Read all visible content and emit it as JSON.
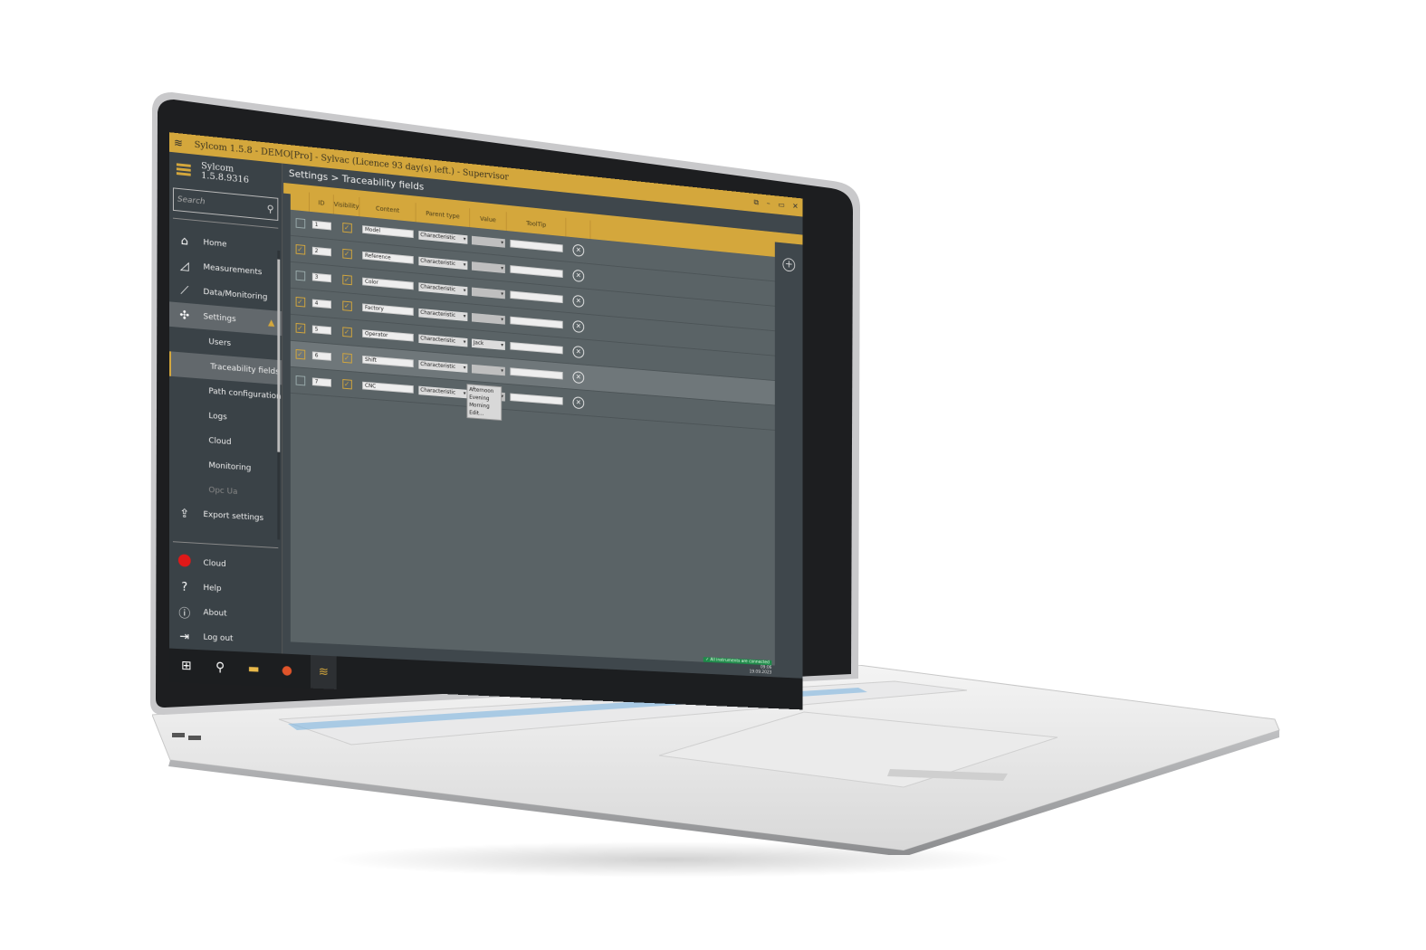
{
  "window": {
    "title": "Sylcom 1.5.8 - DEMO[Pro] - Sylvac (Licence 93 day(s) left.) - Supervisor",
    "buttons": {
      "popout": "⧉",
      "minimize": "–",
      "restore": "▭",
      "close": "✕"
    }
  },
  "sidebar": {
    "app_version": "Sylcom 1.5.8.9316",
    "search_placeholder": "Search",
    "items": [
      {
        "label": "Home",
        "icon": "home-icon",
        "glyph": "⌂"
      },
      {
        "label": "Measurements",
        "icon": "set-square-icon",
        "glyph": "◿"
      },
      {
        "label": "Data/Monitoring",
        "icon": "chart-icon",
        "glyph": "⟋"
      },
      {
        "label": "Settings",
        "icon": "settings-icon",
        "glyph": "✣",
        "expanded": true
      }
    ],
    "sub_items": [
      {
        "label": "Users"
      },
      {
        "label": "Traceability fields",
        "active": true
      },
      {
        "label": "Path configuration"
      },
      {
        "label": "Logs"
      },
      {
        "label": "Cloud"
      },
      {
        "label": "Monitoring"
      },
      {
        "label": "Opc Ua",
        "disabled": true
      }
    ],
    "export": {
      "label": "Export settings",
      "icon": "export-icon",
      "glyph": "⇪"
    },
    "bottom": [
      {
        "label": "Cloud",
        "icon": "cloud-status-icon",
        "status_color": "#e01818"
      },
      {
        "label": "Help",
        "icon": "help-icon",
        "glyph": "?"
      },
      {
        "label": "About",
        "icon": "info-icon",
        "glyph": "ⓘ"
      },
      {
        "label": "Log out",
        "icon": "logout-icon",
        "glyph": "⇥"
      }
    ]
  },
  "main": {
    "breadcrumb": "Settings > Traceability fields",
    "columns": [
      "",
      "ID",
      "Visibility",
      "Content",
      "Parent type",
      "Value",
      "ToolTip",
      ""
    ],
    "rows": [
      {
        "selected": false,
        "id": "1",
        "visible": true,
        "content": "Model",
        "parent_type": "Characteristic",
        "value": "",
        "tooltip": ""
      },
      {
        "selected": true,
        "id": "2",
        "visible": true,
        "content": "Reference",
        "parent_type": "Characteristic",
        "value": "",
        "tooltip": ""
      },
      {
        "selected": false,
        "id": "3",
        "visible": true,
        "content": "Color",
        "parent_type": "Characteristic",
        "value": "",
        "tooltip": ""
      },
      {
        "selected": true,
        "id": "4",
        "visible": true,
        "content": "Factory",
        "parent_type": "Characteristic",
        "value": "",
        "tooltip": ""
      },
      {
        "selected": true,
        "id": "5",
        "visible": true,
        "content": "Operator",
        "parent_type": "Characteristic",
        "value": "Jack",
        "tooltip": ""
      },
      {
        "selected": true,
        "id": "6",
        "visible": true,
        "content": "Shift",
        "parent_type": "Characteristic",
        "value": "",
        "tooltip": "",
        "highlighted": true
      },
      {
        "selected": false,
        "id": "7",
        "visible": true,
        "content": "CNC",
        "parent_type": "Characteristic",
        "value": "",
        "tooltip": ""
      }
    ],
    "value_dropdown_options": [
      "Afternoon",
      "Evening",
      "Morning",
      "Edit..."
    ]
  },
  "status": {
    "connection": "All instruments are connected",
    "time": "09:06",
    "date": "19.09.2023"
  },
  "taskbar": [
    {
      "name": "windows-start-icon",
      "glyph": "⊞"
    },
    {
      "name": "search-icon",
      "glyph": "⚲"
    },
    {
      "name": "file-explorer-icon",
      "glyph": "▭"
    },
    {
      "name": "firefox-icon",
      "glyph": "●"
    },
    {
      "name": "sylcom-app-icon",
      "glyph": "≋",
      "active": true
    }
  ],
  "colors": {
    "accent": "#d4a73c",
    "sidebar": "#3a4247",
    "panel": "#5a6366",
    "status_ok": "#1f8a4a"
  }
}
